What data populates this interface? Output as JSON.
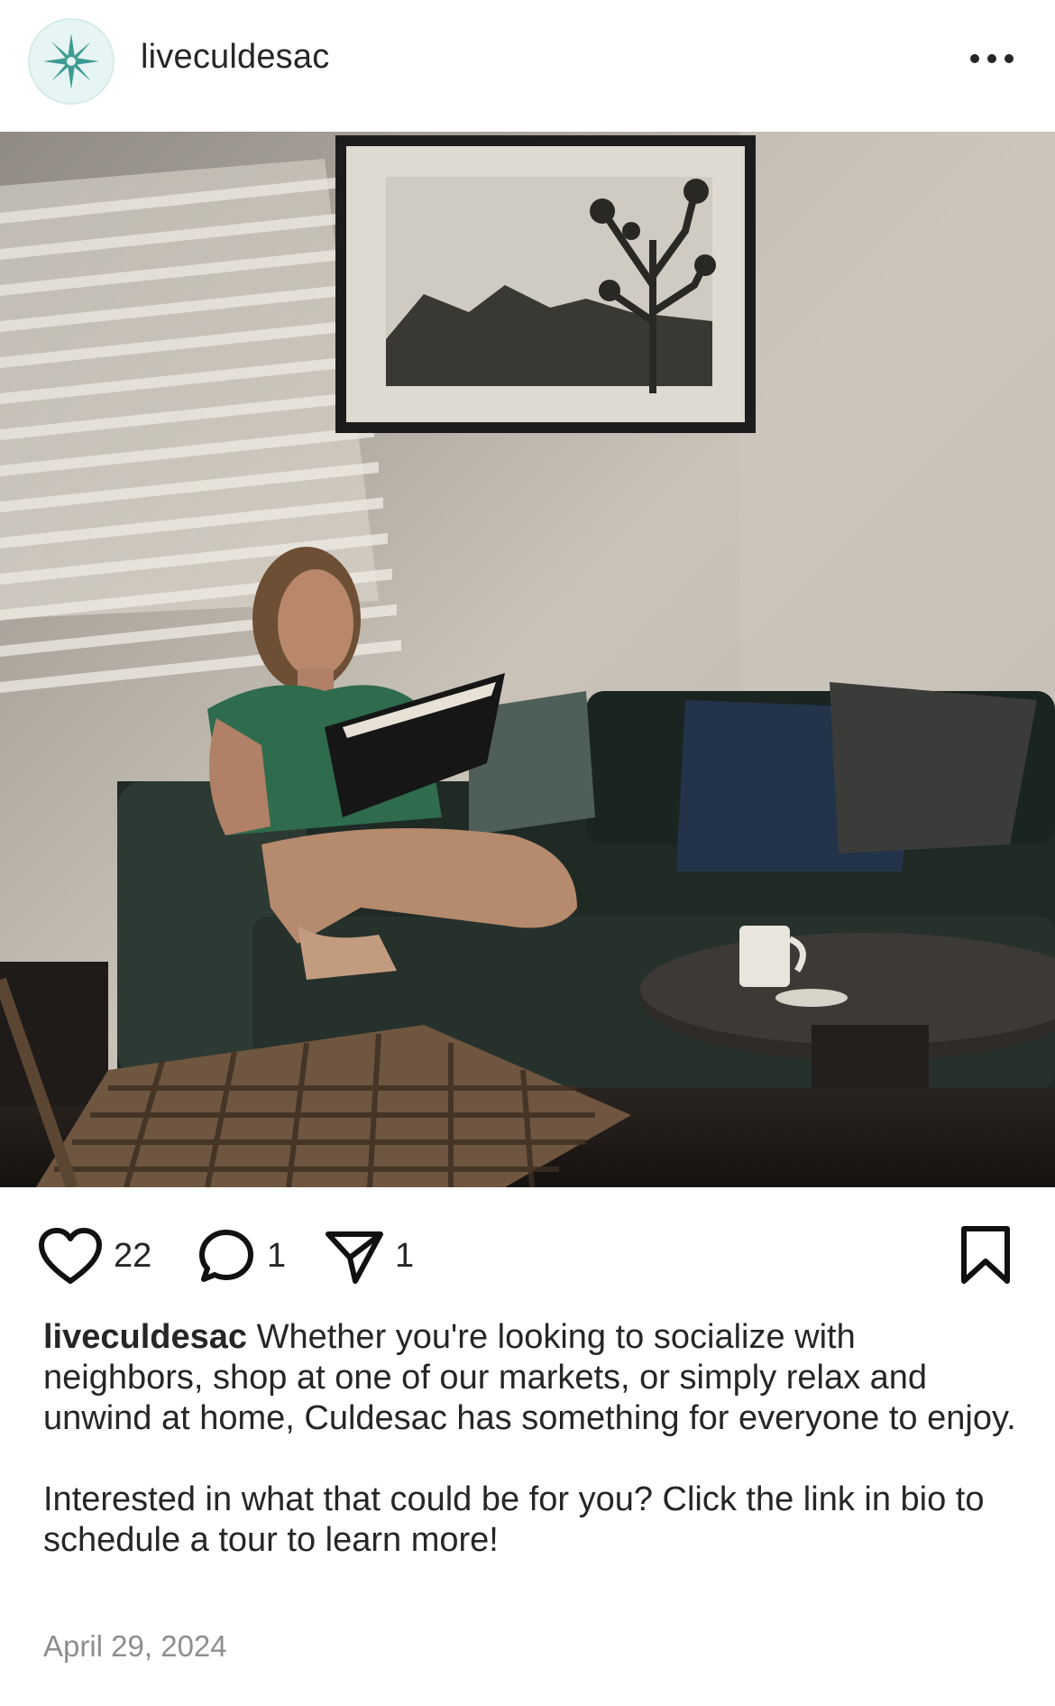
{
  "post": {
    "username": "liveculdesac",
    "avatar_icon": "compass-star-icon",
    "more_icon": "ellipsis-icon",
    "photo_alt": "Woman reading a book on a dark green sofa in a sunlit living room",
    "likes": "22",
    "comments": "1",
    "shares": "1",
    "caption_user": "liveculdesac",
    "caption_line1": "Whether you're looking to socialize with neighbors, shop at one of our markets, or simply relax and unwind at home, Culdesac has something for everyone to enjoy.",
    "caption_line2": "Interested in what that could be for you? Click the link in bio to schedule a tour to learn more!",
    "date": "April 29, 2024"
  },
  "colors": {
    "accent": "#3f9a92",
    "text": "#262626",
    "muted": "#8e8e8e"
  }
}
